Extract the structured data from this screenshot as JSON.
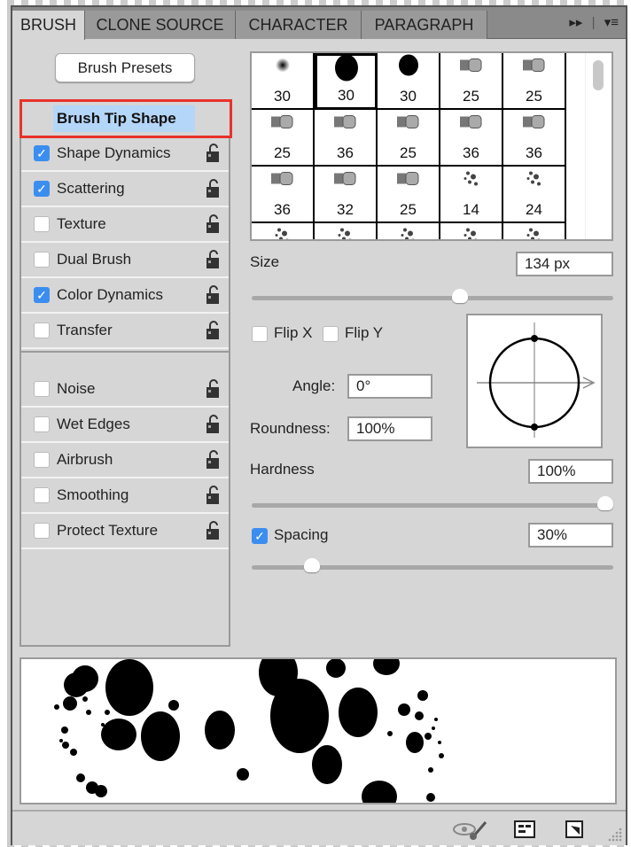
{
  "tabs": [
    {
      "label": "BRUSH",
      "active": true
    },
    {
      "label": "CLONE SOURCE"
    },
    {
      "label": "CHARACTER"
    },
    {
      "label": "PARAGRAPH"
    }
  ],
  "tab_icons": {
    "expand": "▸▸",
    "menu": "▾≡"
  },
  "brush_presets_label": "Brush Presets",
  "brush_tip_shape_label": "Brush Tip Shape",
  "options": [
    {
      "label": "Shape Dynamics",
      "checked": true
    },
    {
      "label": "Scattering",
      "checked": true
    },
    {
      "label": "Texture",
      "checked": false
    },
    {
      "label": "Dual Brush",
      "checked": false
    },
    {
      "label": "Color Dynamics",
      "checked": true
    },
    {
      "label": "Transfer",
      "checked": false
    },
    {
      "label": "Noise",
      "checked": false
    },
    {
      "label": "Wet Edges",
      "checked": false
    },
    {
      "label": "Airbrush",
      "checked": false
    },
    {
      "label": "Smoothing",
      "checked": false
    },
    {
      "label": "Protect Texture",
      "checked": false
    }
  ],
  "brush_sizes": [
    "30",
    "30",
    "30",
    "25",
    "25",
    "25",
    "36",
    "25",
    "36",
    "36",
    "36",
    "32",
    "25",
    "14",
    "24"
  ],
  "selected_brush_index": 1,
  "size": {
    "label": "Size",
    "value": "134 px",
    "slider_fraction": 0.58
  },
  "flip_x": {
    "label": "Flip X",
    "checked": false
  },
  "flip_y": {
    "label": "Flip Y",
    "checked": false
  },
  "angle": {
    "label": "Angle:",
    "value": "0°"
  },
  "roundness": {
    "label": "Roundness:",
    "value": "100%"
  },
  "hardness": {
    "label": "Hardness",
    "value": "100%",
    "slider_fraction": 1.0
  },
  "spacing": {
    "label": "Spacing",
    "checked": true,
    "value": "30%",
    "slider_fraction": 0.15
  },
  "checkmark": "✓"
}
